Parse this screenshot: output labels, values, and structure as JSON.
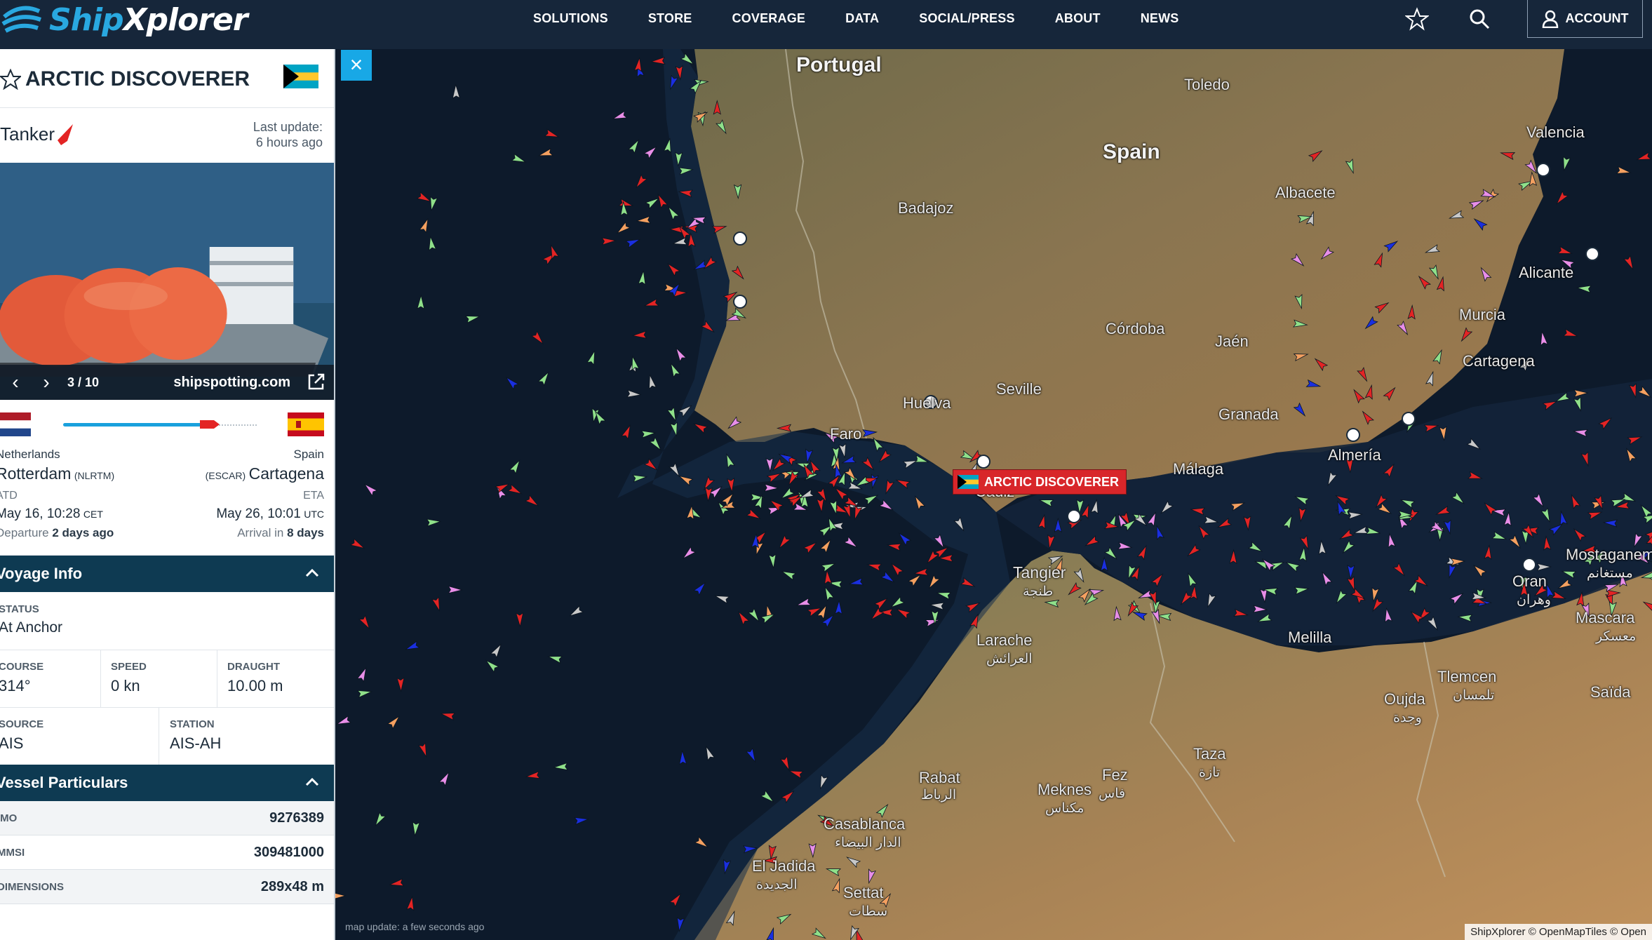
{
  "brand": {
    "name_part1": "Ship",
    "name_part2": "Xplorer"
  },
  "nav": {
    "items": [
      "SOLUTIONS",
      "STORE",
      "COVERAGE",
      "DATA",
      "SOCIAL/PRESS",
      "ABOUT",
      "NEWS"
    ],
    "account_label": "ACCOUNT",
    "icons": [
      "star-icon",
      "search-icon",
      "user-icon"
    ]
  },
  "vessel": {
    "name": "ARCTIC DISCOVERER",
    "type": "Tanker",
    "last_update_label": "Last update:",
    "last_update_value": "6 hours ago",
    "photo_counter": "3 / 10",
    "photo_source": "shipspotting.com",
    "origin": {
      "country": "Netherlands",
      "port": "Rotterdam",
      "code": "(NLRTM)",
      "label": "ATD",
      "date": "May 16, 10:28",
      "tz": "CET",
      "note_prefix": "Departure",
      "note_value": "2 days ago"
    },
    "destination": {
      "country": "Spain",
      "port": "Cartagena",
      "code": "(ESCAR)",
      "label": "ETA",
      "date": "May 26, 10:01",
      "tz": "UTC",
      "note_prefix": "Arrival in",
      "note_value": "8 days"
    },
    "progress": 0.72
  },
  "voyage_info": {
    "title": "Voyage Info",
    "status_label": "STATUS",
    "status": "At Anchor",
    "course_label": "COURSE",
    "course": "314°",
    "speed_label": "SPEED",
    "speed": "0 kn",
    "draught_label": "DRAUGHT",
    "draught": "10.00 m",
    "source_label": "SOURCE",
    "source": "AIS",
    "station_label": "STATION",
    "station": "AIS-AH"
  },
  "particulars": {
    "title": "Vessel Particulars",
    "rows": [
      {
        "key": "IMO",
        "value": "9276389"
      },
      {
        "key": "MMSI",
        "value": "309481000"
      },
      {
        "key": "DIMENSIONS",
        "value": "289x48 m"
      }
    ]
  },
  "map": {
    "vessel_tag": "ARCTIC DISCOVERER",
    "status": "map update: a few seconds ago",
    "attribution": "ShipXplorer © OpenMapTiles © Open",
    "places": {
      "portugal": "Portugal",
      "spain": "Spain",
      "toledo": "Toledo",
      "badajoz": "Badajoz",
      "albacete": "Albacete",
      "cordoba": "Córdoba",
      "jaen": "Jaén",
      "seville": "Seville",
      "granada": "Granada",
      "murcia": "Murcia",
      "cartagena": "Cartagena",
      "huelva": "Huelva",
      "faro": "Faro",
      "cadiz": "Cádiz",
      "malaga": "Málaga",
      "almeria": "Almería",
      "tangier": "Tangier",
      "tangier_ar": "طنجة",
      "larache": "Larache",
      "larache_ar": "العرائش",
      "rabat": "Rabat",
      "rabat_ar": "الرباط",
      "casablanca": "Casablanca",
      "casablanca_ar": "الدار البيضاء",
      "eljadida": "El Jadida",
      "eljadida_ar": "الجديدة",
      "settat": "Settat",
      "settat_ar": "سطات",
      "meknes": "Meknes",
      "meknes_ar": "مكناس",
      "fez": "Fez",
      "fez_ar": "فاس",
      "taza": "Taza",
      "taza_ar": "تازة",
      "oujda": "Oujda",
      "oujda_ar": "وجدة",
      "tlemcen": "Tlemcen",
      "tlemcen_ar": "تلمسان",
      "mascara": "Mascara",
      "mascara_ar": "معسكر",
      "saida": "Saïda",
      "oran": "Oran",
      "oran_ar": "وهران",
      "melilla": "Melilla",
      "valencia": "Valencia",
      "alicante": "Alicante",
      "mostaganem": "Mostaganem",
      "mostaganem_ar": "مستغانم"
    }
  },
  "colors": {
    "nav_bg": "#16263a",
    "brand_blue": "#29a8e0",
    "section_head": "#0e3a52",
    "vessel_tag": "#d8262a",
    "route": "#1aa1dd"
  }
}
